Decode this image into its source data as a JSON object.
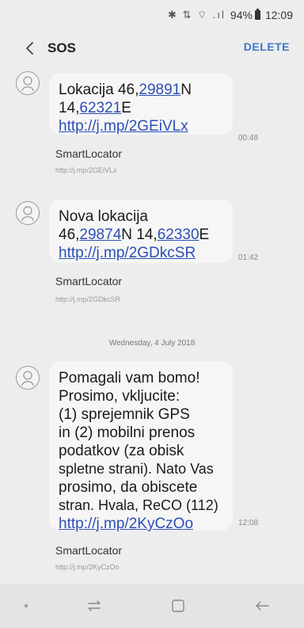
{
  "status_bar": {
    "signal_icons": "✱ ⇅ ⌔ .ıl",
    "battery": "94%",
    "time": "12:09"
  },
  "header": {
    "title": "SOS",
    "delete_label": "DELETE"
  },
  "messages": [
    {
      "line1": "Lokacija  46,",
      "line1_link": "29891",
      "line1_tail": "N",
      "line2": "14,",
      "line2_link": "62321",
      "line2_tail": "E",
      "url": "http://j.mp/2GEiVLx",
      "time": "00:48",
      "sender": "SmartLocator",
      "preview_url": "http://j.mp/2GEiVLx"
    },
    {
      "line1": "Nova lokacija",
      "line2": "46,",
      "line2_link": "29874",
      "line2_mid": "N  14,",
      "line2_link2": "62330",
      "line2_tail": "E",
      "url": "http://j.mp/2GDkcSR",
      "time": "01:42",
      "sender": "SmartLocator",
      "preview_url": "http://j.mp/2GDkcSR"
    },
    {
      "lines": [
        "Pomagali vam bomo!",
        "Prosimo, vkljucite:",
        "(1) sprejemnik GPS",
        "in (2) mobilni prenos",
        "podatkov (za obisk",
        "spletne strani). Nato Vas",
        "prosimo, da obiscete",
        "stran. Hvala, ReCO (112)"
      ],
      "url": "http://j.mp/2KyCzOo",
      "time": "12:08",
      "sender": "SmartLocator",
      "preview_url": "http://j.mp/2KyCzOo"
    }
  ],
  "date_separator": "Wednesday, 4 July 2018",
  "nav": {
    "items": [
      "recent-apps",
      "home",
      "back"
    ]
  },
  "colors": {
    "accent": "#3a78c9",
    "link": "#2d4fb4",
    "background": "#ededed",
    "bubble": "#f6f6f6"
  }
}
